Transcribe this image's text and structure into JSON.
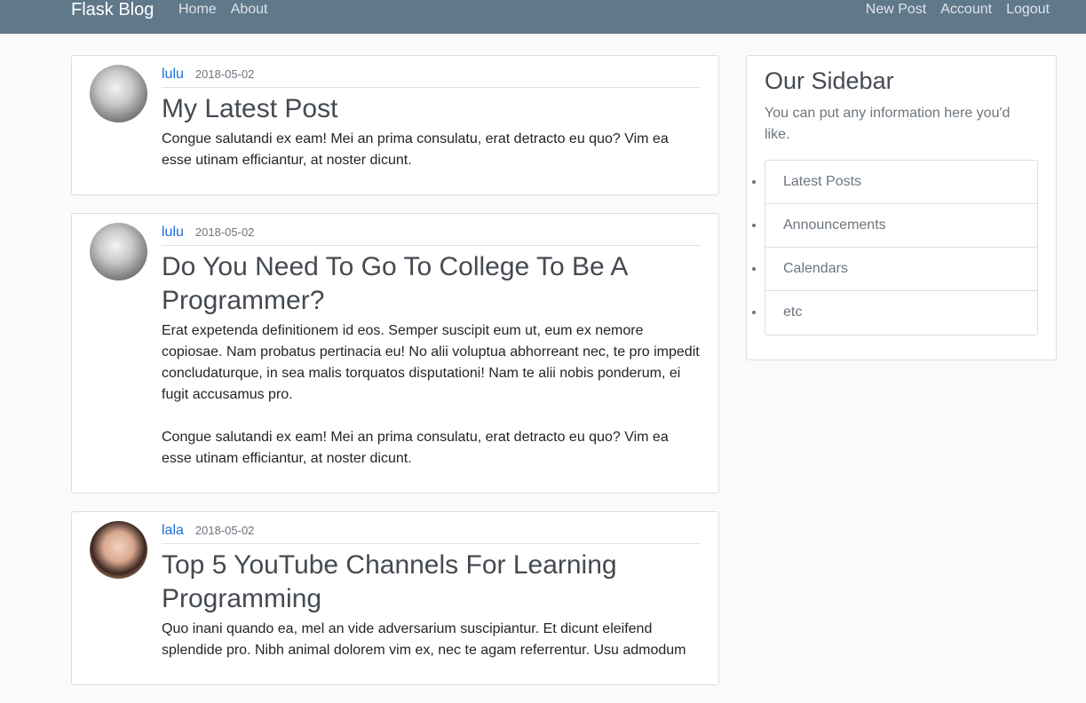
{
  "navbar": {
    "brand": "Flask Blog",
    "left_links": [
      "Home",
      "About"
    ],
    "right_links": [
      "New Post",
      "Account",
      "Logout"
    ]
  },
  "posts": [
    {
      "author": "lulu",
      "date": "2018-05-02",
      "title": "My Latest Post",
      "paragraphs": [
        "Congue salutandi ex eam! Mei an prima consulatu, erat detracto eu quo? Vim ea esse utinam efficiantur, at noster dicunt."
      ]
    },
    {
      "author": "lulu",
      "date": "2018-05-02",
      "title": "Do You Need To Go To College To Be A Programmer?",
      "paragraphs": [
        "Erat expetenda definitionem id eos. Semper suscipit eum ut, eum ex nemore copiosae. Nam probatus pertinacia eu! No alii voluptua abhorreant nec, te pro impedit concludaturque, in sea malis torquatos disputationi! Nam te alii nobis ponderum, ei fugit accusamus pro.",
        "Congue salutandi ex eam! Mei an prima consulatu, erat detracto eu quo? Vim ea esse utinam efficiantur, at noster dicunt."
      ]
    },
    {
      "author": "lala",
      "date": "2018-05-02",
      "title": "Top 5 YouTube Channels For Learning Programming",
      "paragraphs": [
        "Quo inani quando ea, mel an vide adversarium suscipiantur. Et dicunt eleifend splendide pro. Nibh animal dolorem vim ex, nec te agam referrentur. Usu admodum"
      ]
    }
  ],
  "sidebar": {
    "title": "Our Sidebar",
    "text": "You can put any information here you'd like.",
    "items": [
      "Latest Posts",
      "Announcements",
      "Calendars",
      "etc"
    ]
  }
}
